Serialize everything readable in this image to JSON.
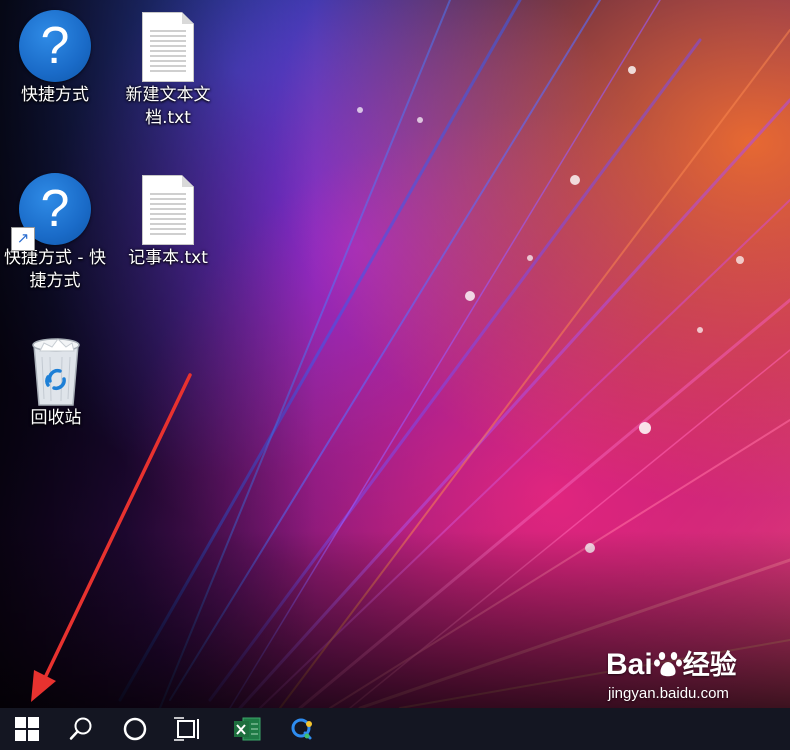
{
  "desktop": {
    "icons": [
      {
        "label": "快捷方式",
        "kind": "help-icon"
      },
      {
        "label": "新建文本文档.txt",
        "kind": "text-document-icon"
      },
      {
        "label": "快捷方式 - 快捷方式",
        "kind": "help-shortcut-icon"
      },
      {
        "label": "记事本.txt",
        "kind": "text-document-icon"
      },
      {
        "label": "回收站",
        "kind": "recycle-bin-icon"
      }
    ]
  },
  "watermark": {
    "brand_text": "Bai",
    "brand_cn": "经验",
    "url": "jingyan.baidu.com"
  },
  "annotation": {
    "arrow_color": "#e8322f"
  },
  "taskbar": {
    "background": "#141622",
    "buttons": [
      "windows-start-icon",
      "search-icon",
      "cortana-icon",
      "task-view-icon",
      "excel-icon",
      "app-icon"
    ]
  }
}
